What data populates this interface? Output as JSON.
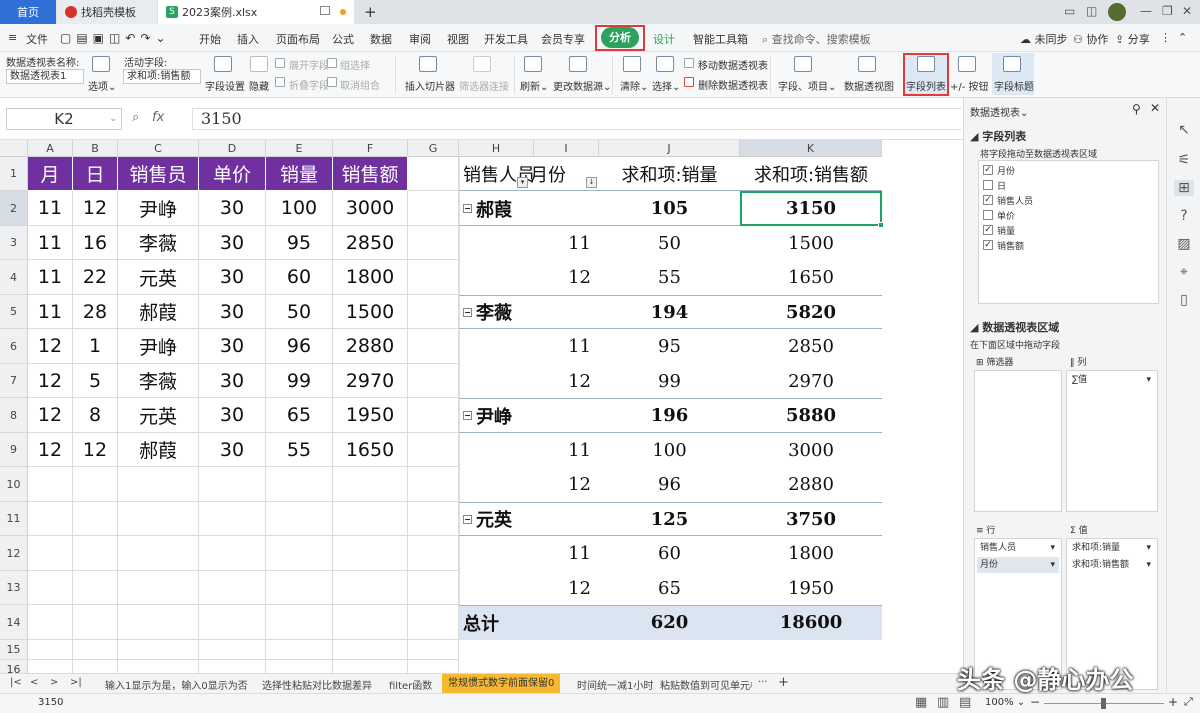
{
  "tabs": {
    "home": "首页",
    "template": "找稻壳模板",
    "file": "2023案例.xlsx",
    "new": "+"
  },
  "menu": {
    "file": "文件",
    "items": [
      "开始",
      "插入",
      "页面布局",
      "公式",
      "数据",
      "审阅",
      "视图",
      "开发工具",
      "会员专享"
    ],
    "active": "分析",
    "after": [
      "设计",
      "智能工具箱"
    ],
    "search": "查找命令、搜索模板",
    "sync": "未同步",
    "collab": "协作",
    "share": "分享"
  },
  "ribbon": {
    "pivot_name_label": "数据透视表名称:",
    "pivot_name": "数据透视表1",
    "options": "选项",
    "active_field_label": "活动字段:",
    "active_field": "求和项:销售额",
    "field_settings": "字段设置",
    "hide": "隐藏",
    "expand_field": "展开字段",
    "collapse_field": "折叠字段",
    "group_select": "组选择",
    "ungroup": "取消组合",
    "insert_slicer": "插入切片器",
    "filter_connect": "筛选器连接",
    "refresh": "刷新",
    "change_source": "更改数据源",
    "clear": "清除",
    "select": "选择",
    "move_pivot": "移动数据透视表",
    "delete_pivot": "删除数据透视表",
    "fields_items": "字段、项目",
    "pivot_chart": "数据透视图",
    "field_list": "字段列表",
    "plus_minus": "+/- 按钮",
    "field_headers": "字段标题"
  },
  "formula": {
    "cell_ref": "K2",
    "fx": "fx",
    "value": "3150"
  },
  "grid": {
    "columns": [
      "A",
      "B",
      "C",
      "D",
      "E",
      "F",
      "G",
      "H",
      "I",
      "J",
      "K"
    ],
    "rows": [
      "1",
      "2",
      "3",
      "4",
      "5",
      "6",
      "7",
      "8",
      "9",
      "10",
      "11",
      "12",
      "13",
      "14",
      "15",
      "16"
    ],
    "source_headers": [
      "月",
      "日",
      "销售员",
      "单价",
      "销量",
      "销售额"
    ],
    "source_rows": [
      [
        "11",
        "12",
        "尹峥",
        "30",
        "100",
        "3000"
      ],
      [
        "11",
        "16",
        "李薇",
        "30",
        "95",
        "2850"
      ],
      [
        "11",
        "22",
        "元英",
        "30",
        "60",
        "1800"
      ],
      [
        "11",
        "28",
        "郝葭",
        "30",
        "50",
        "1500"
      ],
      [
        "12",
        "1",
        "尹峥",
        "30",
        "96",
        "2880"
      ],
      [
        "12",
        "5",
        "李薇",
        "30",
        "99",
        "2970"
      ],
      [
        "12",
        "8",
        "元英",
        "30",
        "65",
        "1950"
      ],
      [
        "12",
        "12",
        "郝葭",
        "30",
        "55",
        "1650"
      ]
    ]
  },
  "pivot": {
    "hdr_person": "销售人员",
    "hdr_month": "月份",
    "hdr_qty": "求和项:销量",
    "hdr_amount": "求和项:销售额",
    "rows": [
      {
        "type": "group",
        "label": "郝葭",
        "qty": "105",
        "amt": "3150"
      },
      {
        "type": "item",
        "label": "11",
        "qty": "50",
        "amt": "1500"
      },
      {
        "type": "item",
        "label": "12",
        "qty": "55",
        "amt": "1650"
      },
      {
        "type": "group",
        "label": "李薇",
        "qty": "194",
        "amt": "5820"
      },
      {
        "type": "item",
        "label": "11",
        "qty": "95",
        "amt": "2850"
      },
      {
        "type": "item",
        "label": "12",
        "qty": "99",
        "amt": "2970"
      },
      {
        "type": "group",
        "label": "尹峥",
        "qty": "196",
        "amt": "5880"
      },
      {
        "type": "item",
        "label": "11",
        "qty": "100",
        "amt": "3000"
      },
      {
        "type": "item",
        "label": "12",
        "qty": "96",
        "amt": "2880"
      },
      {
        "type": "group",
        "label": "元英",
        "qty": "125",
        "amt": "3750"
      },
      {
        "type": "item",
        "label": "11",
        "qty": "60",
        "amt": "1800"
      },
      {
        "type": "item",
        "label": "12",
        "qty": "65",
        "amt": "1950"
      }
    ],
    "total_label": "总计",
    "total_qty": "620",
    "total_amt": "18600"
  },
  "sheet_tabs": [
    "输入1显示为是，输入0显示为否",
    "选择性粘贴对比数据差异",
    "filter函数",
    "常规惯式数字前面保留0",
    "时间统一减1小时",
    "粘贴数值到可见单元格",
    "···",
    "+"
  ],
  "active_sheet": "常规惯式数字前面保留0",
  "status": {
    "value": "3150",
    "zoom": "100%"
  },
  "panel": {
    "title": "数据透视表",
    "field_list_title": "字段列表",
    "field_hint": "将字段拖动至数据透视表区域",
    "fields": [
      {
        "name": "月份",
        "checked": true
      },
      {
        "name": "日",
        "checked": false
      },
      {
        "name": "销售人员",
        "checked": true
      },
      {
        "name": "单价",
        "checked": false
      },
      {
        "name": "销量",
        "checked": true
      },
      {
        "name": "销售额",
        "checked": true
      }
    ],
    "area_title": "数据透视表区域",
    "area_hint": "在下面区域中拖动字段",
    "filter": "筛选器",
    "columns": "列",
    "column_value": "∑值",
    "rows": "行",
    "values": "值",
    "row_items": [
      "销售人员",
      "月份"
    ],
    "value_items": [
      "求和项:销量",
      "求和项:销售额"
    ]
  },
  "watermark": "头条 @静心办公",
  "accent": {
    "purple": "#7030a0",
    "green": "#2aa35e",
    "red": "#e23a3a",
    "pivot_total": "#dbe5f1"
  }
}
